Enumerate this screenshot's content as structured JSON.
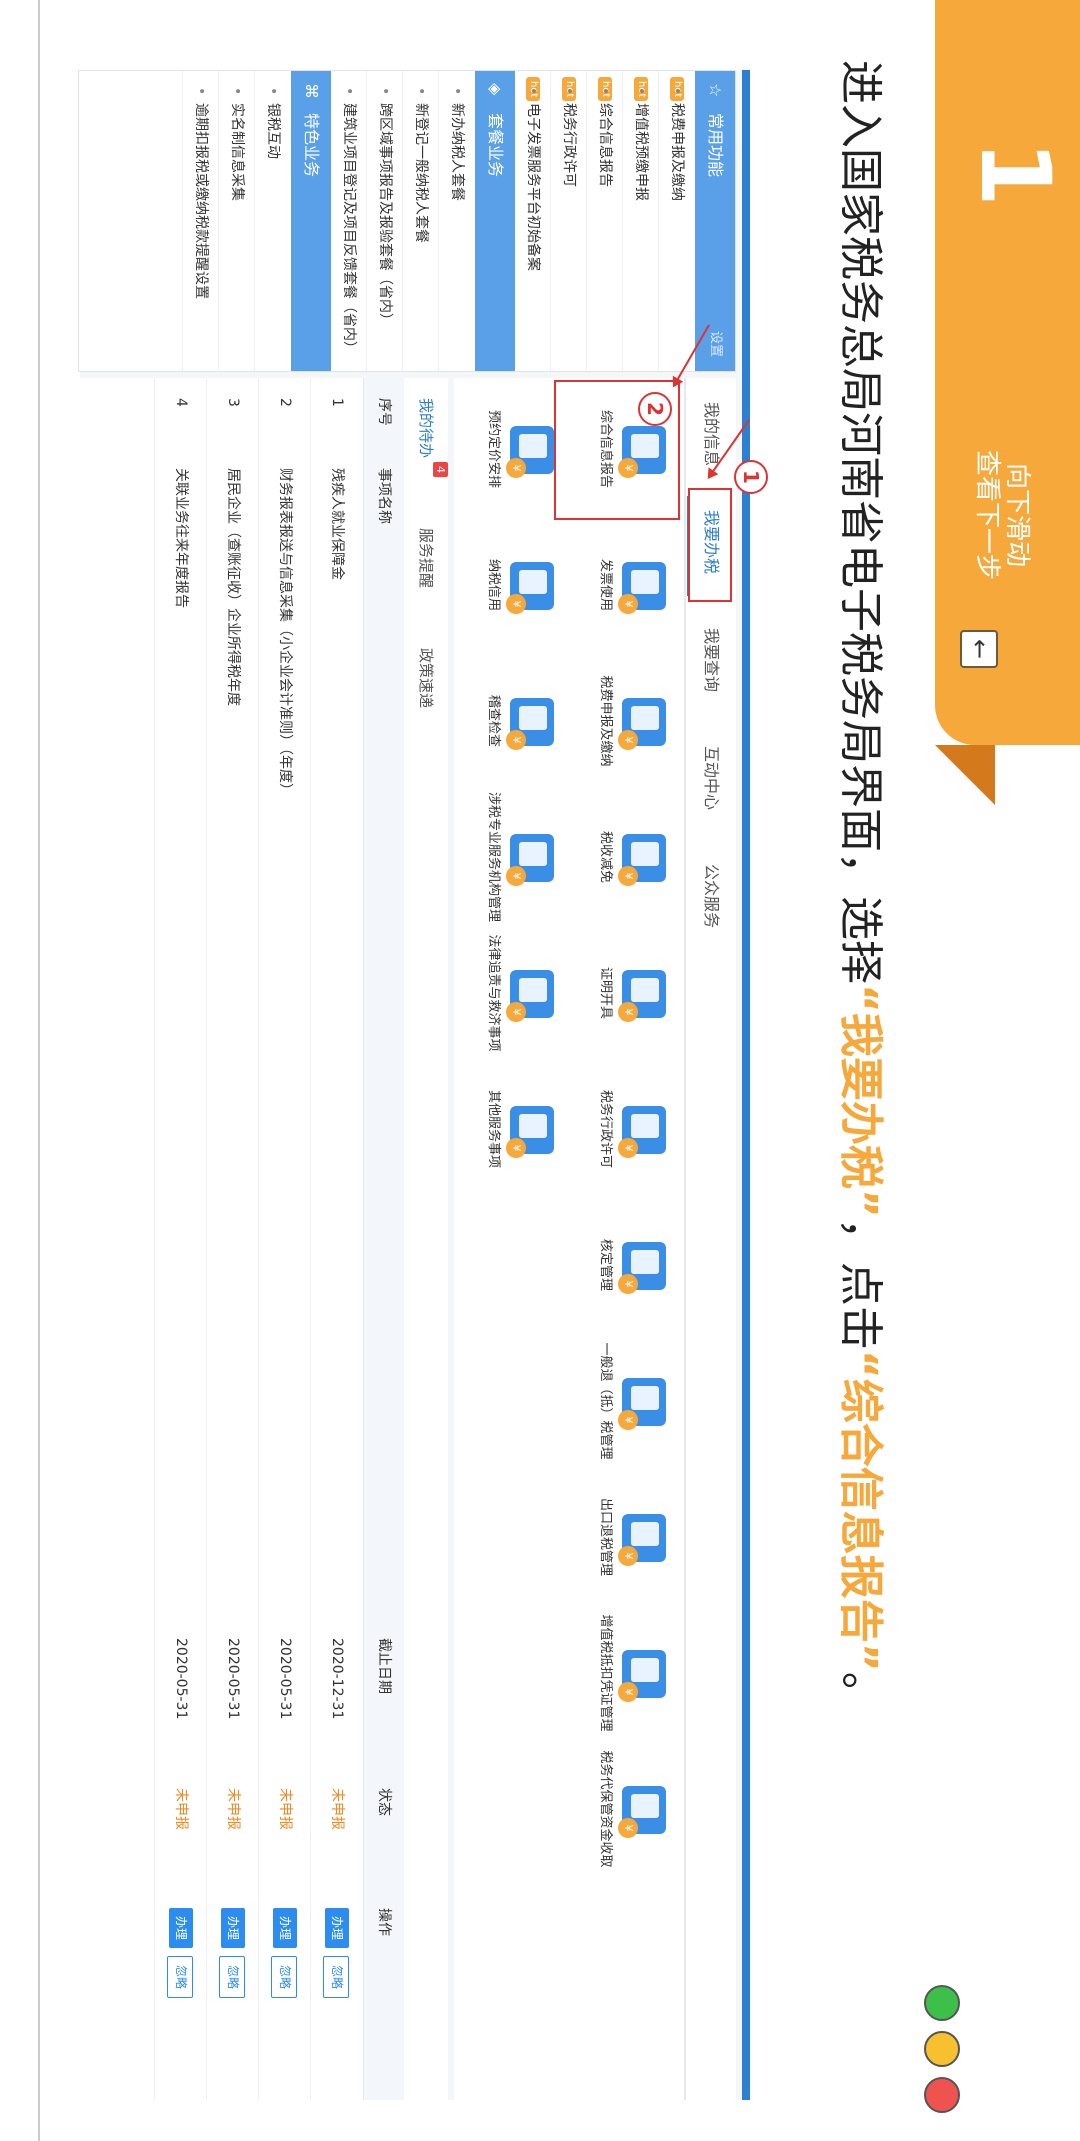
{
  "header": {
    "step_number": "1",
    "hint_line1": "向下滑动",
    "hint_line2": "查看下一步",
    "hint_button_icon": "arrow-left-icon"
  },
  "instruction": {
    "part1": "进入国家税务总局河南省电子税务局界面，选择",
    "highlight1": "“我要办税”",
    "part2": "，点击",
    "highlight2": "“综合信息报告”",
    "part3": "。"
  },
  "colors": {
    "orange": "#f6a83a",
    "blue": "#2d7fd2",
    "dot_green": "#3cc04a",
    "dot_yellow": "#f7c02f",
    "dot_red": "#ef5350"
  },
  "left_menu": {
    "common": {
      "title": "常用功能",
      "more": "设置",
      "items": [
        {
          "label": "税费申报及缴纳",
          "hot": "hot"
        },
        {
          "label": "增值税预缴申报",
          "hot": "hot"
        },
        {
          "label": "综合信息报告",
          "hot": "hot"
        },
        {
          "label": "税务行政许可",
          "hot": "hot"
        },
        {
          "label": "电子发票服务平台初始备案",
          "hot": "hot"
        }
      ]
    },
    "package": {
      "title": "套餐业务",
      "items": [
        {
          "label": "新办纳税人套餐"
        },
        {
          "label": "新登记一般纳税人套餐"
        },
        {
          "label": "跨区域事项报告及报验套餐（省内）"
        },
        {
          "label": "建筑业项目登记及项目反馈套餐（省内）"
        }
      ]
    },
    "special": {
      "title": "特色业务",
      "items": [
        {
          "label": "银税互动"
        },
        {
          "label": "实名制信息采集"
        },
        {
          "label": "逾期扣报税或缴纳税款提醒设置"
        }
      ]
    }
  },
  "main_tabs": [
    "我的信息",
    "我要办税",
    "我要查询",
    "互动中心",
    "公众服务"
  ],
  "annotations": {
    "circle1": "1",
    "circle2": "2"
  },
  "services": [
    "综合信息报告",
    "发票使用",
    "税费申报及缴纳",
    "税收减免",
    "证明开具",
    "税务行政许可",
    "核定管理",
    "一般退（抵）税管理",
    "出口退税管理",
    "增值税抵扣凭证管理",
    "税务代保管资金收取",
    "预约定价安排",
    "纳税信用",
    "稽查检查",
    "涉税专业服务机构管理",
    "法律追责与救济事项",
    "其他服务事项"
  ],
  "panel": {
    "tabs": [
      "我的待办",
      "服务提醒",
      "政策速递"
    ],
    "todo_count": "4",
    "columns": [
      "序号",
      "事项名称",
      "截止日期",
      "状态",
      "操作"
    ],
    "rows": [
      {
        "no": "1",
        "name": "残疾人就业保障金",
        "deadline": "2020-12-31",
        "status": "未申报",
        "do": "办理",
        "ignore": "忽略"
      },
      {
        "no": "2",
        "name": "财务报表报送与信息采集（小企业会计准则）（年度）",
        "deadline": "2020-05-31",
        "status": "未申报",
        "do": "办理",
        "ignore": "忽略"
      },
      {
        "no": "3",
        "name": "居民企业（查账征收）企业所得税年度",
        "deadline": "2020-05-31",
        "status": "未申报",
        "do": "办理",
        "ignore": "忽略"
      },
      {
        "no": "4",
        "name": "关联业务往来年度报告",
        "deadline": "2020-05-31",
        "status": "未申报",
        "do": "办理",
        "ignore": "忽略"
      }
    ]
  }
}
